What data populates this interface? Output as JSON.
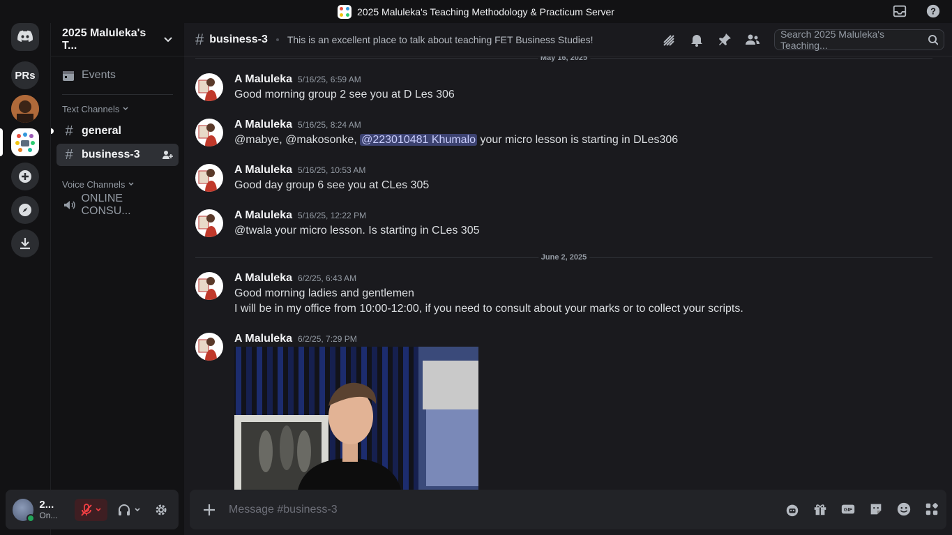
{
  "titlebar": {
    "title": "2025 Maluleka's Teaching Methodology & Practicum Server"
  },
  "guilds": {
    "prs_label": "PRs"
  },
  "sidebar": {
    "server_name": "2025 Maluleka's T...",
    "events_label": "Events",
    "text_category": "Text Channels",
    "voice_category": "Voice Channels",
    "channels": [
      {
        "name": "general"
      },
      {
        "name": "business-3"
      }
    ],
    "voice_channels": [
      {
        "name": "ONLINE CONSU..."
      }
    ]
  },
  "user": {
    "name": "2...",
    "status": "On..."
  },
  "header": {
    "channel": "business-3",
    "topic": "This is an excellent place to talk about teaching FET Business Studies!",
    "search_placeholder": "Search 2025 Maluleka's Teaching..."
  },
  "dividers": [
    "May 16, 2025",
    "June 2, 2025"
  ],
  "messages": [
    {
      "author": "A Maluleka",
      "time": "5/16/25, 6:59 AM",
      "lines": [
        "Good morning group 2 see you at D Les 306"
      ]
    },
    {
      "author": "A Maluleka",
      "time": "5/16/25, 8:24 AM",
      "pre": "@mabye, @makosonke, ",
      "mention": "@223010481 Khumalo",
      "post": " your micro lesson is starting in DLes306"
    },
    {
      "author": "A Maluleka",
      "time": "5/16/25, 10:53 AM",
      "lines": [
        "Good day group 6 see you at CLes 305"
      ]
    },
    {
      "author": "A Maluleka",
      "time": "5/16/25, 12:22 PM",
      "lines": [
        "@twala your micro lesson. Is starting in CLes 305"
      ]
    },
    {
      "author": "A Maluleka",
      "time": "6/2/25, 6:43 AM",
      "lines": [
        "Good morning ladies and gentlemen",
        "I will be in my office from 10:00-12:00, if you need to consult about your marks or to collect your scripts."
      ]
    },
    {
      "author": "A Maluleka",
      "time": "6/2/25, 7:29 PM",
      "lines": []
    }
  ],
  "composer": {
    "placeholder": "Message #business-3"
  },
  "colors": {
    "accent": "#5865f2",
    "online": "#23a55a",
    "mention_bg": "#3c4270"
  }
}
